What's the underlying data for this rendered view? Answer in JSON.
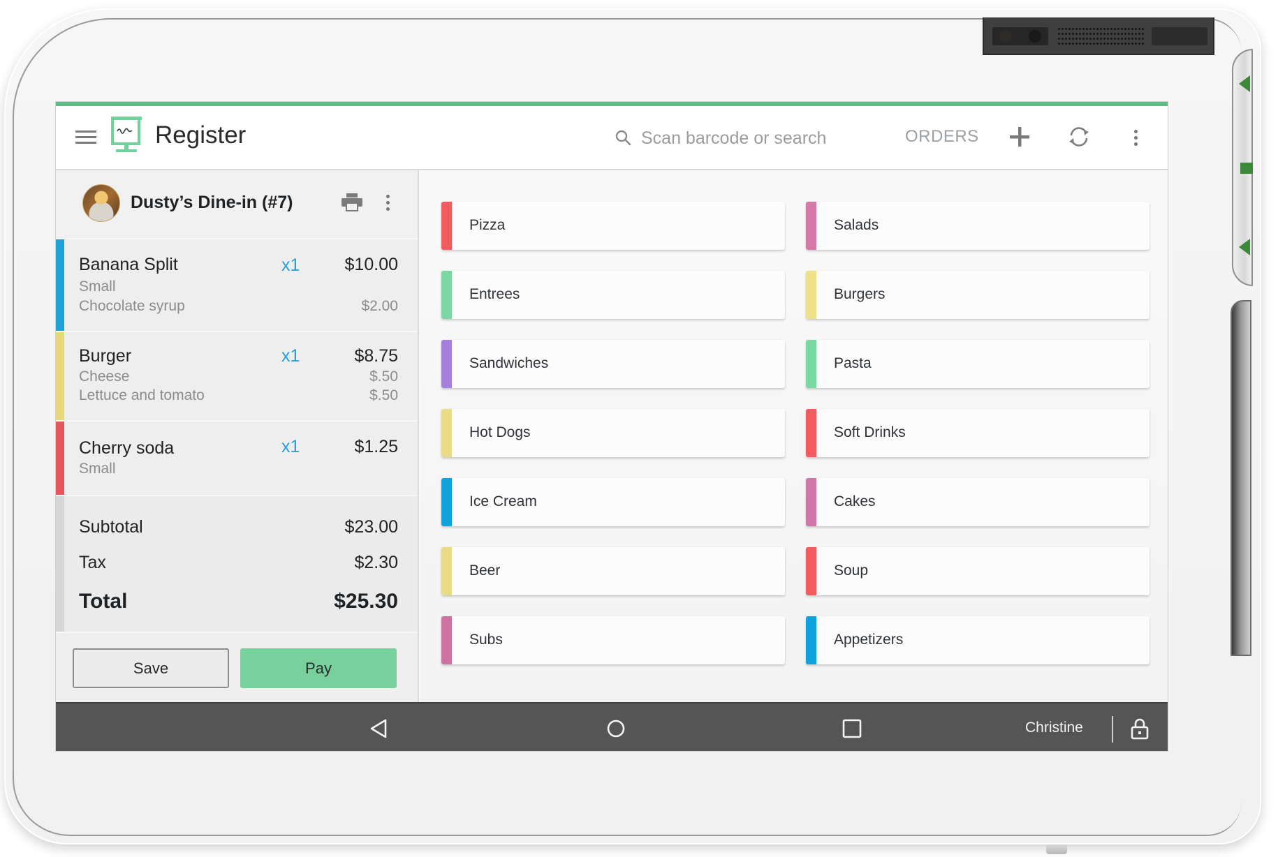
{
  "app": {
    "title": "Register",
    "accent_color": "#5bbd84"
  },
  "header": {
    "search_placeholder": "Scan barcode or search",
    "orders_label": "ORDERS",
    "icons": [
      "menu-icon",
      "register-logo-icon",
      "search-icon",
      "add-icon",
      "sync-icon",
      "more-vert-icon"
    ]
  },
  "order": {
    "name": "Dusty’s Dine-in (#7)",
    "items": [
      {
        "name": "Banana Split",
        "qty": "x1",
        "price": "$10.00",
        "color": "#1ea3d8",
        "modifiers": [
          {
            "name": "Small",
            "price": ""
          },
          {
            "name": "Chocolate syrup",
            "price": "$2.00"
          }
        ]
      },
      {
        "name": "Burger",
        "qty": "x1",
        "price": "$8.75",
        "color": "#e9d77c",
        "modifiers": [
          {
            "name": "Cheese",
            "price": "$.50"
          },
          {
            "name": "Lettuce and tomato",
            "price": "$.50"
          }
        ]
      },
      {
        "name": "Cherry soda",
        "qty": "x1",
        "price": "$1.25",
        "color": "#e8565c",
        "modifiers": [
          {
            "name": "Small",
            "price": ""
          }
        ]
      }
    ],
    "subtotal_label": "Subtotal",
    "subtotal": "$23.00",
    "tax_label": "Tax",
    "tax": "$2.30",
    "total_label": "Total",
    "total": "$25.30",
    "save_label": "Save",
    "pay_label": "Pay"
  },
  "categories": [
    {
      "label": "Pizza",
      "color": "#f25c61"
    },
    {
      "label": "Salads",
      "color": "#d57aa8"
    },
    {
      "label": "Entrees",
      "color": "#79d9a1"
    },
    {
      "label": "Burgers",
      "color": "#efe08a"
    },
    {
      "label": "Sandwiches",
      "color": "#a47fdb"
    },
    {
      "label": "Pasta",
      "color": "#79d9a1"
    },
    {
      "label": "Hot Dogs",
      "color": "#e9dc88"
    },
    {
      "label": "Soft Drinks",
      "color": "#f25c61"
    },
    {
      "label": "Ice Cream",
      "color": "#0fa2dc"
    },
    {
      "label": "Cakes",
      "color": "#cf78a8"
    },
    {
      "label": "Beer",
      "color": "#e9dc88"
    },
    {
      "label": "Soup",
      "color": "#f25c61"
    },
    {
      "label": "Subs",
      "color": "#cc73a1"
    },
    {
      "label": "Appetizers",
      "color": "#0fa2dc"
    }
  ],
  "navbar": {
    "user": "Christine",
    "icons": [
      "back-icon",
      "home-icon",
      "recents-icon",
      "lock-icon"
    ]
  }
}
